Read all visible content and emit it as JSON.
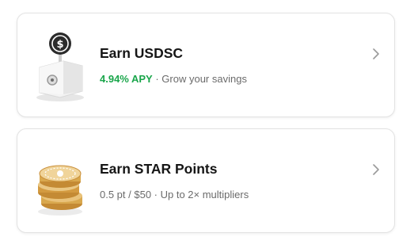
{
  "cards": [
    {
      "title": "Earn USDSC",
      "apy": "4.94% APY",
      "separator": " · ",
      "subtitle": "Grow your savings",
      "icon": "safe-with-coin-icon"
    },
    {
      "title": "Earn STAR Points",
      "subtitle": "0.5 pt / $50 · Up to 2× multipliers",
      "icon": "coin-stack-icon"
    }
  ],
  "colors": {
    "apy_green": "#1aa64b",
    "title": "#161616",
    "subtitle": "#6b6b6b",
    "gold": "#d9a84e"
  },
  "chevron_icon": "chevron-right-icon"
}
